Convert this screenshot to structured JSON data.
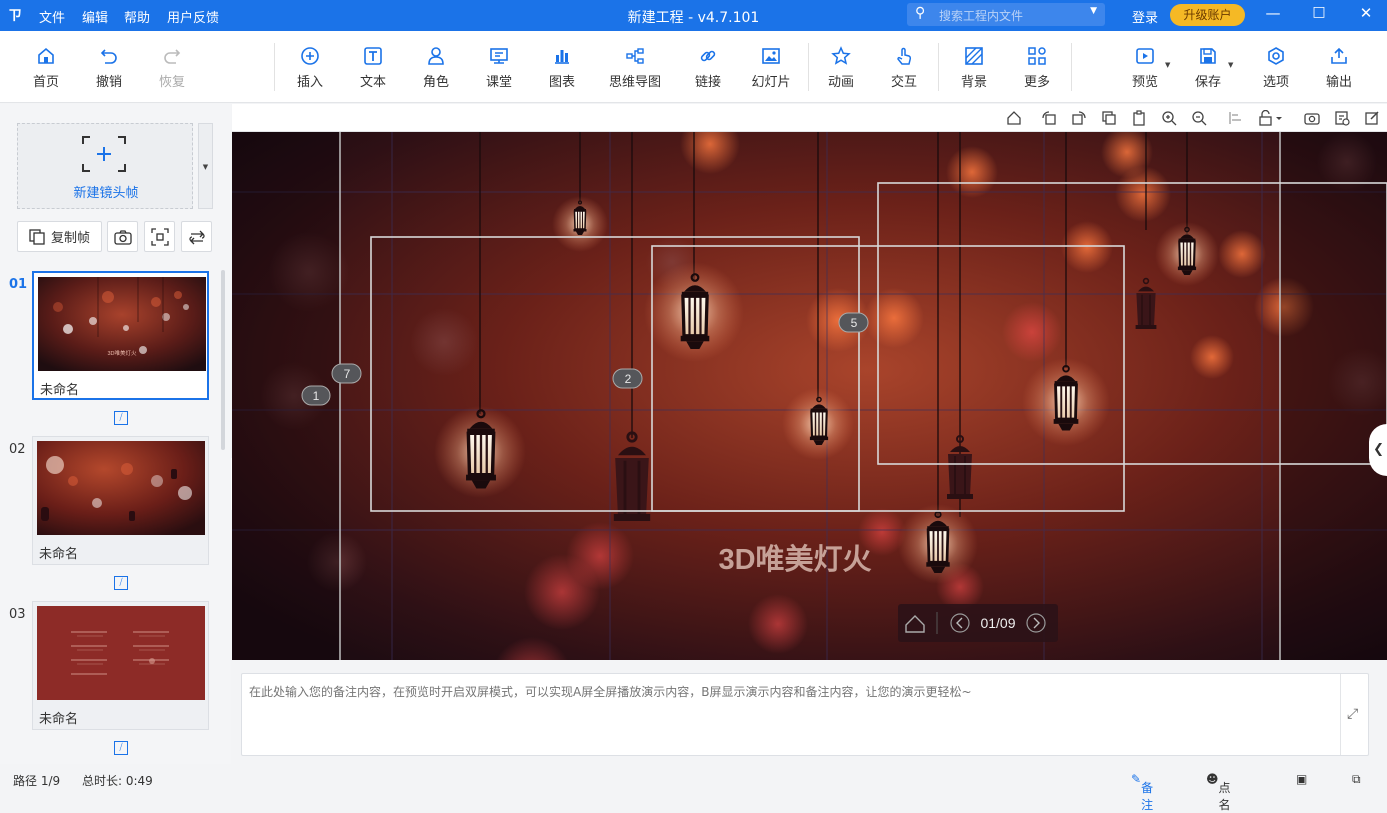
{
  "window": {
    "title": "新建工程 - v4.7.101",
    "menus": [
      "文件",
      "编辑",
      "帮助",
      "用户反馈"
    ],
    "search_placeholder": "搜索工程内文件",
    "login": "登录",
    "upgrade": "升级账户"
  },
  "toolbar": {
    "home": "首页",
    "undo": "撤销",
    "redo": "恢复",
    "insert": "插入",
    "text": "文本",
    "role": "角色",
    "classroom": "课堂",
    "chart": "图表",
    "mindmap": "思维导图",
    "link": "链接",
    "slideshow": "幻灯片",
    "animation": "动画",
    "interact": "交互",
    "background": "背景",
    "more": "更多",
    "preview": "预览",
    "save": "保存",
    "options": "选项",
    "export": "输出"
  },
  "left_panel": {
    "new_frame": "新建镜头帧",
    "copy_frame": "复制帧",
    "frames": [
      {
        "num": "01",
        "name": "未命名",
        "caption": "3D唯美灯火"
      },
      {
        "num": "02",
        "name": "未命名"
      },
      {
        "num": "03",
        "name": "未命名"
      }
    ]
  },
  "canvas": {
    "caption": "3D唯美灯火",
    "frame_markers": [
      "1",
      "7",
      "2",
      "5"
    ],
    "page_indicator": "01/09"
  },
  "notes": {
    "placeholder": "在此处输入您的备注内容，在预览时开启双屏模式，可以实现A屏全屏播放演示内容，B屏显示演示内容和备注内容，让您的演示更轻松~"
  },
  "status": {
    "path": "路径 1/9",
    "duration": "总时长: 0:49",
    "notes_btn": "备注",
    "rollcall_btn": "点名"
  },
  "colors": {
    "accent": "#1b73e8",
    "upgrade": "#f5b925"
  }
}
